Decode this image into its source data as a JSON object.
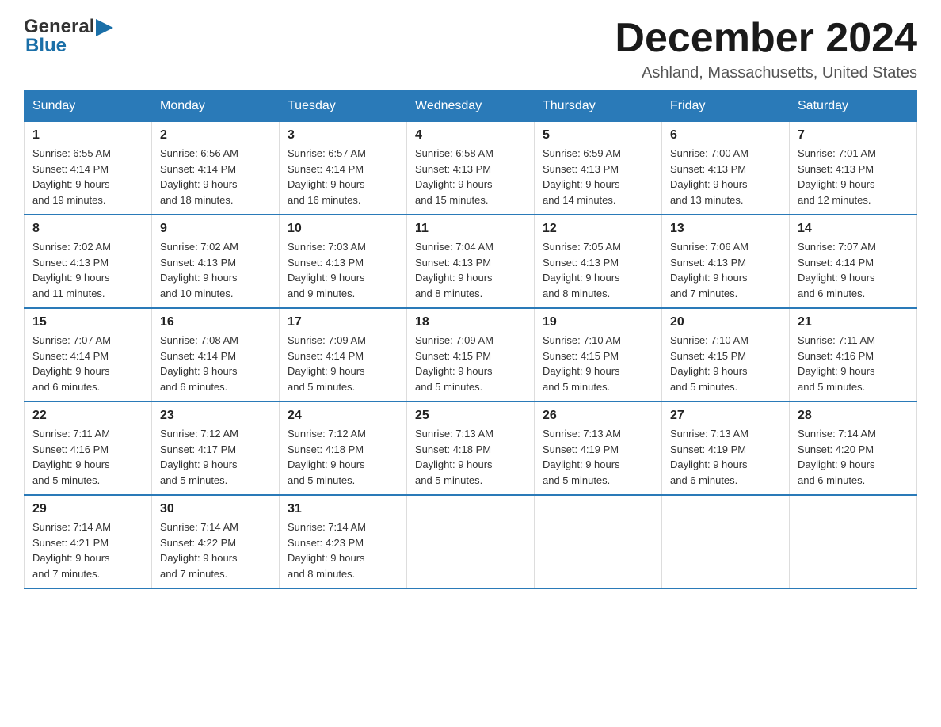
{
  "header": {
    "logo_general": "General",
    "logo_blue": "Blue",
    "month_title": "December 2024",
    "location": "Ashland, Massachusetts, United States"
  },
  "days_of_week": [
    "Sunday",
    "Monday",
    "Tuesday",
    "Wednesday",
    "Thursday",
    "Friday",
    "Saturday"
  ],
  "weeks": [
    [
      {
        "day": "1",
        "sunrise": "6:55 AM",
        "sunset": "4:14 PM",
        "daylight": "9 hours and 19 minutes."
      },
      {
        "day": "2",
        "sunrise": "6:56 AM",
        "sunset": "4:14 PM",
        "daylight": "9 hours and 18 minutes."
      },
      {
        "day": "3",
        "sunrise": "6:57 AM",
        "sunset": "4:14 PM",
        "daylight": "9 hours and 16 minutes."
      },
      {
        "day": "4",
        "sunrise": "6:58 AM",
        "sunset": "4:13 PM",
        "daylight": "9 hours and 15 minutes."
      },
      {
        "day": "5",
        "sunrise": "6:59 AM",
        "sunset": "4:13 PM",
        "daylight": "9 hours and 14 minutes."
      },
      {
        "day": "6",
        "sunrise": "7:00 AM",
        "sunset": "4:13 PM",
        "daylight": "9 hours and 13 minutes."
      },
      {
        "day": "7",
        "sunrise": "7:01 AM",
        "sunset": "4:13 PM",
        "daylight": "9 hours and 12 minutes."
      }
    ],
    [
      {
        "day": "8",
        "sunrise": "7:02 AM",
        "sunset": "4:13 PM",
        "daylight": "9 hours and 11 minutes."
      },
      {
        "day": "9",
        "sunrise": "7:02 AM",
        "sunset": "4:13 PM",
        "daylight": "9 hours and 10 minutes."
      },
      {
        "day": "10",
        "sunrise": "7:03 AM",
        "sunset": "4:13 PM",
        "daylight": "9 hours and 9 minutes."
      },
      {
        "day": "11",
        "sunrise": "7:04 AM",
        "sunset": "4:13 PM",
        "daylight": "9 hours and 8 minutes."
      },
      {
        "day": "12",
        "sunrise": "7:05 AM",
        "sunset": "4:13 PM",
        "daylight": "9 hours and 8 minutes."
      },
      {
        "day": "13",
        "sunrise": "7:06 AM",
        "sunset": "4:13 PM",
        "daylight": "9 hours and 7 minutes."
      },
      {
        "day": "14",
        "sunrise": "7:07 AM",
        "sunset": "4:14 PM",
        "daylight": "9 hours and 6 minutes."
      }
    ],
    [
      {
        "day": "15",
        "sunrise": "7:07 AM",
        "sunset": "4:14 PM",
        "daylight": "9 hours and 6 minutes."
      },
      {
        "day": "16",
        "sunrise": "7:08 AM",
        "sunset": "4:14 PM",
        "daylight": "9 hours and 6 minutes."
      },
      {
        "day": "17",
        "sunrise": "7:09 AM",
        "sunset": "4:14 PM",
        "daylight": "9 hours and 5 minutes."
      },
      {
        "day": "18",
        "sunrise": "7:09 AM",
        "sunset": "4:15 PM",
        "daylight": "9 hours and 5 minutes."
      },
      {
        "day": "19",
        "sunrise": "7:10 AM",
        "sunset": "4:15 PM",
        "daylight": "9 hours and 5 minutes."
      },
      {
        "day": "20",
        "sunrise": "7:10 AM",
        "sunset": "4:15 PM",
        "daylight": "9 hours and 5 minutes."
      },
      {
        "day": "21",
        "sunrise": "7:11 AM",
        "sunset": "4:16 PM",
        "daylight": "9 hours and 5 minutes."
      }
    ],
    [
      {
        "day": "22",
        "sunrise": "7:11 AM",
        "sunset": "4:16 PM",
        "daylight": "9 hours and 5 minutes."
      },
      {
        "day": "23",
        "sunrise": "7:12 AM",
        "sunset": "4:17 PM",
        "daylight": "9 hours and 5 minutes."
      },
      {
        "day": "24",
        "sunrise": "7:12 AM",
        "sunset": "4:18 PM",
        "daylight": "9 hours and 5 minutes."
      },
      {
        "day": "25",
        "sunrise": "7:13 AM",
        "sunset": "4:18 PM",
        "daylight": "9 hours and 5 minutes."
      },
      {
        "day": "26",
        "sunrise": "7:13 AM",
        "sunset": "4:19 PM",
        "daylight": "9 hours and 5 minutes."
      },
      {
        "day": "27",
        "sunrise": "7:13 AM",
        "sunset": "4:19 PM",
        "daylight": "9 hours and 6 minutes."
      },
      {
        "day": "28",
        "sunrise": "7:14 AM",
        "sunset": "4:20 PM",
        "daylight": "9 hours and 6 minutes."
      }
    ],
    [
      {
        "day": "29",
        "sunrise": "7:14 AM",
        "sunset": "4:21 PM",
        "daylight": "9 hours and 7 minutes."
      },
      {
        "day": "30",
        "sunrise": "7:14 AM",
        "sunset": "4:22 PM",
        "daylight": "9 hours and 7 minutes."
      },
      {
        "day": "31",
        "sunrise": "7:14 AM",
        "sunset": "4:23 PM",
        "daylight": "9 hours and 8 minutes."
      },
      null,
      null,
      null,
      null
    ]
  ],
  "labels": {
    "sunrise": "Sunrise:",
    "sunset": "Sunset:",
    "daylight": "Daylight:"
  },
  "colors": {
    "header_bg": "#2a7ab8",
    "header_text": "#ffffff",
    "border": "#2a7ab8"
  }
}
